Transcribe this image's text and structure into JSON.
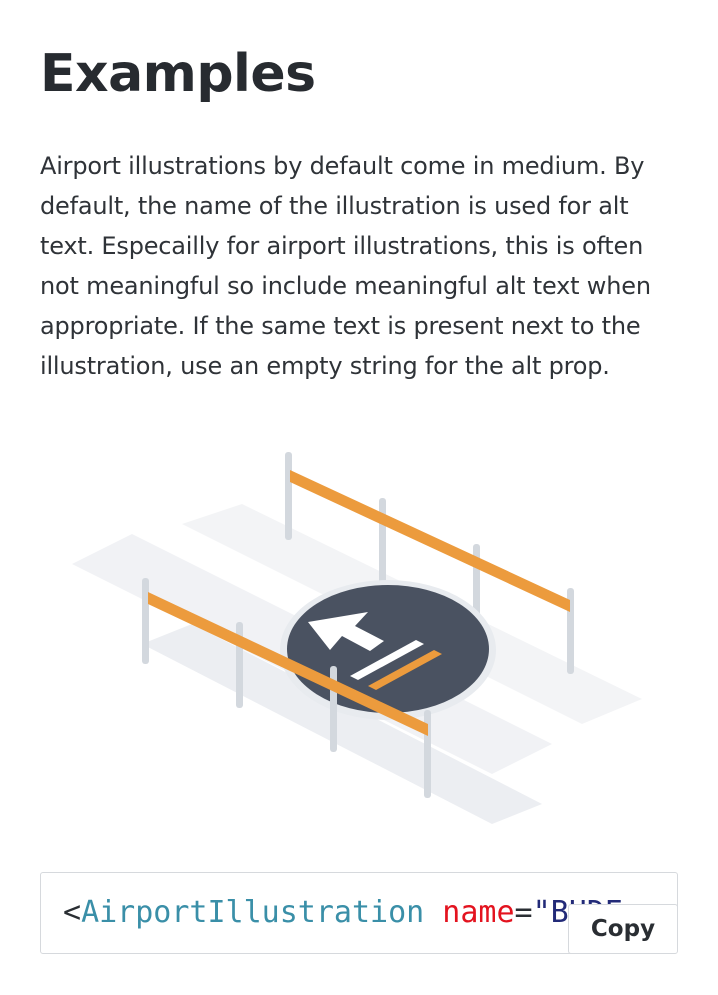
{
  "heading": "Examples",
  "description": "Airport illustrations by default come in medium. By default, the name of the illustration is used for alt text. Especailly for airport illustrations, this is often not meaningful so include meaningful alt text when appropriate. If the same text is present next to the illustration, use an empty string for the alt prop.",
  "illustration": {
    "subject": "airport runway / gate marker",
    "colors": {
      "barrier": "#ec9b3d",
      "pole": "#d3d8de",
      "disc": "#4a5261",
      "marking": "#ffffff"
    }
  },
  "code": {
    "open": "<",
    "tag": "AirportIllustration",
    "attr": "name",
    "eq": "=",
    "value": "\"BUDE"
  },
  "copy_label": "Copy"
}
